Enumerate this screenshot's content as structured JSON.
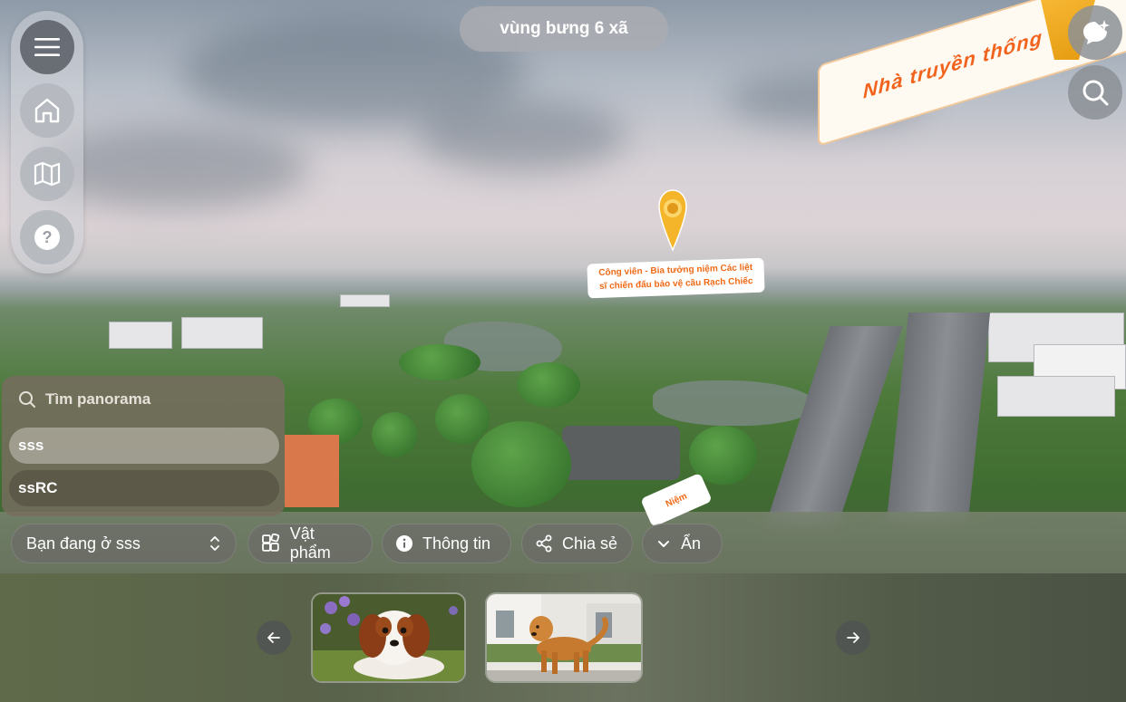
{
  "header": {
    "title": "vùng bưng 6 xã"
  },
  "side_menu": {
    "items": [
      {
        "icon": "menu-icon"
      },
      {
        "icon": "home-icon"
      },
      {
        "icon": "map-icon"
      },
      {
        "icon": "help-icon"
      }
    ]
  },
  "top_right": {
    "ai_button_icon": "chat-sparkle-icon",
    "search_button_icon": "search-icon"
  },
  "scene": {
    "sign_text": "Nhà truyền thống",
    "hotspot_line1": "Công viên - Bia tưởng niệm Các liệt",
    "hotspot_line2": "sĩ chiến đấu bảo vệ cầu Rạch Chiếc",
    "hotspot_bottom_text": "Niệm"
  },
  "search_panel": {
    "placeholder": "Tìm panorama",
    "results": [
      "sss",
      "ssRC"
    ]
  },
  "toolbar": {
    "location_label": "Bạn đang ở sss",
    "items_label": "Vật phẩm",
    "info_label": "Thông tin",
    "share_label": "Chia sẻ",
    "hide_label": "Ẩn"
  },
  "colors": {
    "accent_orange": "#f1631d",
    "pin_yellow": "#f4b52a",
    "panel_brown": "#786c60"
  }
}
